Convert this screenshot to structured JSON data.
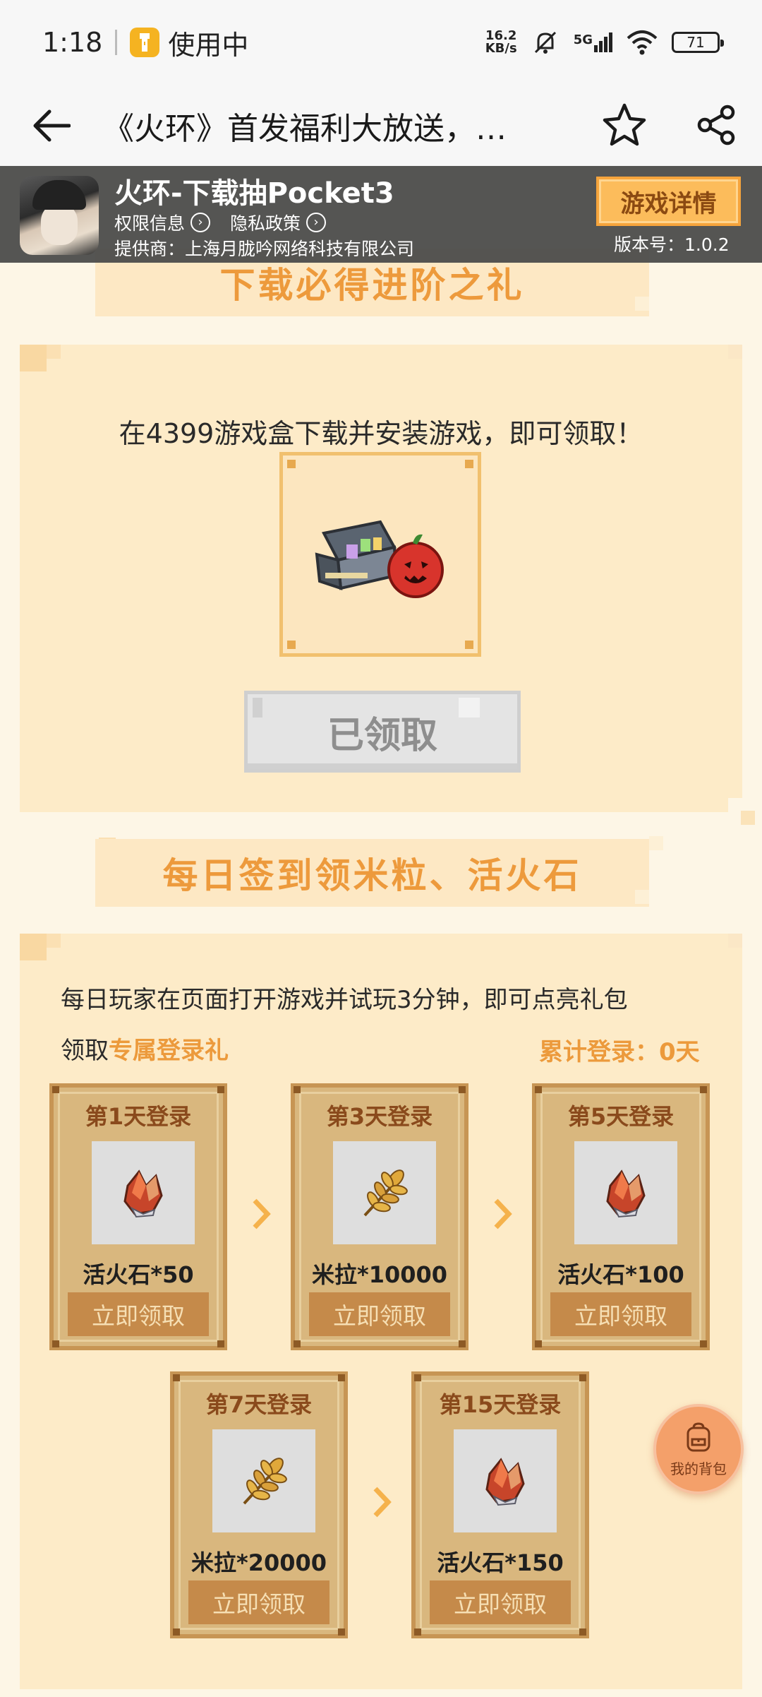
{
  "status_bar": {
    "time": "1:18",
    "app_status": "使用中",
    "net_speed_value": "16.2",
    "net_speed_unit": "KB/s",
    "network": "5G",
    "battery": "71"
  },
  "nav": {
    "title": "《火环》首发福利大放送，…"
  },
  "game_header": {
    "name": "火环-下载抽Pocket3",
    "permission_link": "权限信息",
    "privacy_link": "隐私政策",
    "provider": "提供商：上海月胧吟网络科技有限公司",
    "detail_button": "游戏详情",
    "version": "版本号：1.0.2"
  },
  "section1": {
    "banner": "下载必得进阶之礼",
    "description": "在4399游戏盒下载并安装游戏，即可领取！",
    "gift_icon": "treasure-chest-icon",
    "claimed_button": "已领取"
  },
  "section2": {
    "banner": "每日签到领米粒、活火石",
    "description_line1": "每日玩家在页面打开游戏并试玩3分钟，即可点亮礼包",
    "description_prefix": "领取",
    "description_highlight": "专属登录礼",
    "cumulative": "累计登录：0天",
    "rewards": [
      {
        "title": "第1天登录",
        "amount": "活火石*50",
        "button": "立即领取",
        "icon": "fire-crystal-icon"
      },
      {
        "title": "第3天登录",
        "amount": "米拉*10000",
        "button": "立即领取",
        "icon": "wheat-icon"
      },
      {
        "title": "第5天登录",
        "amount": "活火石*100",
        "button": "立即领取",
        "icon": "fire-crystal-icon"
      },
      {
        "title": "第7天登录",
        "amount": "米拉*20000",
        "button": "立即领取",
        "icon": "wheat-icon"
      },
      {
        "title": "第15天登录",
        "amount": "活火石*150",
        "button": "立即领取",
        "icon": "fire-crystal-icon"
      }
    ]
  },
  "backpack": {
    "label": "我的背包"
  },
  "colors": {
    "accent": "#ec9a3c",
    "background": "#fdf6e6",
    "card": "#fdebc8",
    "reward_card": "#d9b77e"
  }
}
